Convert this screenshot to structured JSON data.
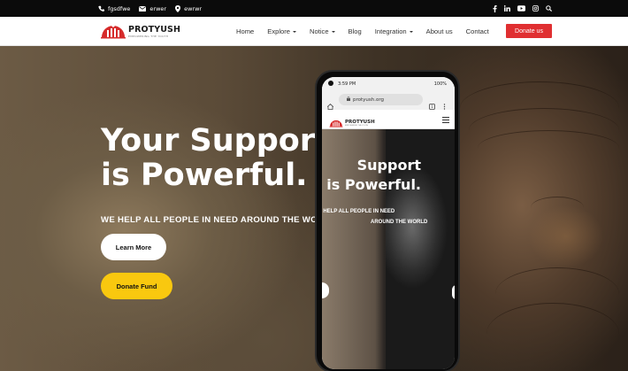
{
  "topbar": {
    "phone_text": "fgsdfwe",
    "email_text": "erwer",
    "location_text": "ewrwr",
    "social_icons": [
      "facebook-icon",
      "linkedin-icon",
      "youtube-icon",
      "instagram-icon",
      "search-icon"
    ]
  },
  "brand": {
    "name": "PROTYUSH",
    "tagline": "EMPOWERING THE YOUTH",
    "logo_color": "#d62b2b"
  },
  "nav": {
    "items": [
      {
        "label": "Home",
        "dropdown": false
      },
      {
        "label": "Explore",
        "dropdown": true
      },
      {
        "label": "Notice",
        "dropdown": true
      },
      {
        "label": "Blog",
        "dropdown": false
      },
      {
        "label": "Integration",
        "dropdown": true
      },
      {
        "label": "About us",
        "dropdown": false
      },
      {
        "label": "Contact",
        "dropdown": false
      }
    ],
    "donate_label": "Donate us"
  },
  "hero": {
    "headline_line1": "Your Support",
    "headline_line2": "is Powerful.",
    "subheading": "WE HELP ALL PEOPLE IN NEED AROUND THE WORLD",
    "learn_label": "Learn More",
    "donate_label": "Donate Fund"
  },
  "phone": {
    "time": "3:59 PM",
    "battery": "100%",
    "url": "protyush.org",
    "brand": "PROTYUSH",
    "headline_line1": "Support",
    "headline_line2": "is Powerful.",
    "sub_line1": "WE HELP ALL PEOPLE IN NEED",
    "sub_line2": "AROUND THE WORLD"
  },
  "colors": {
    "accent_red": "#e02f31",
    "accent_yellow": "#f9c80f",
    "topbar_bg": "#0b0b0b"
  }
}
